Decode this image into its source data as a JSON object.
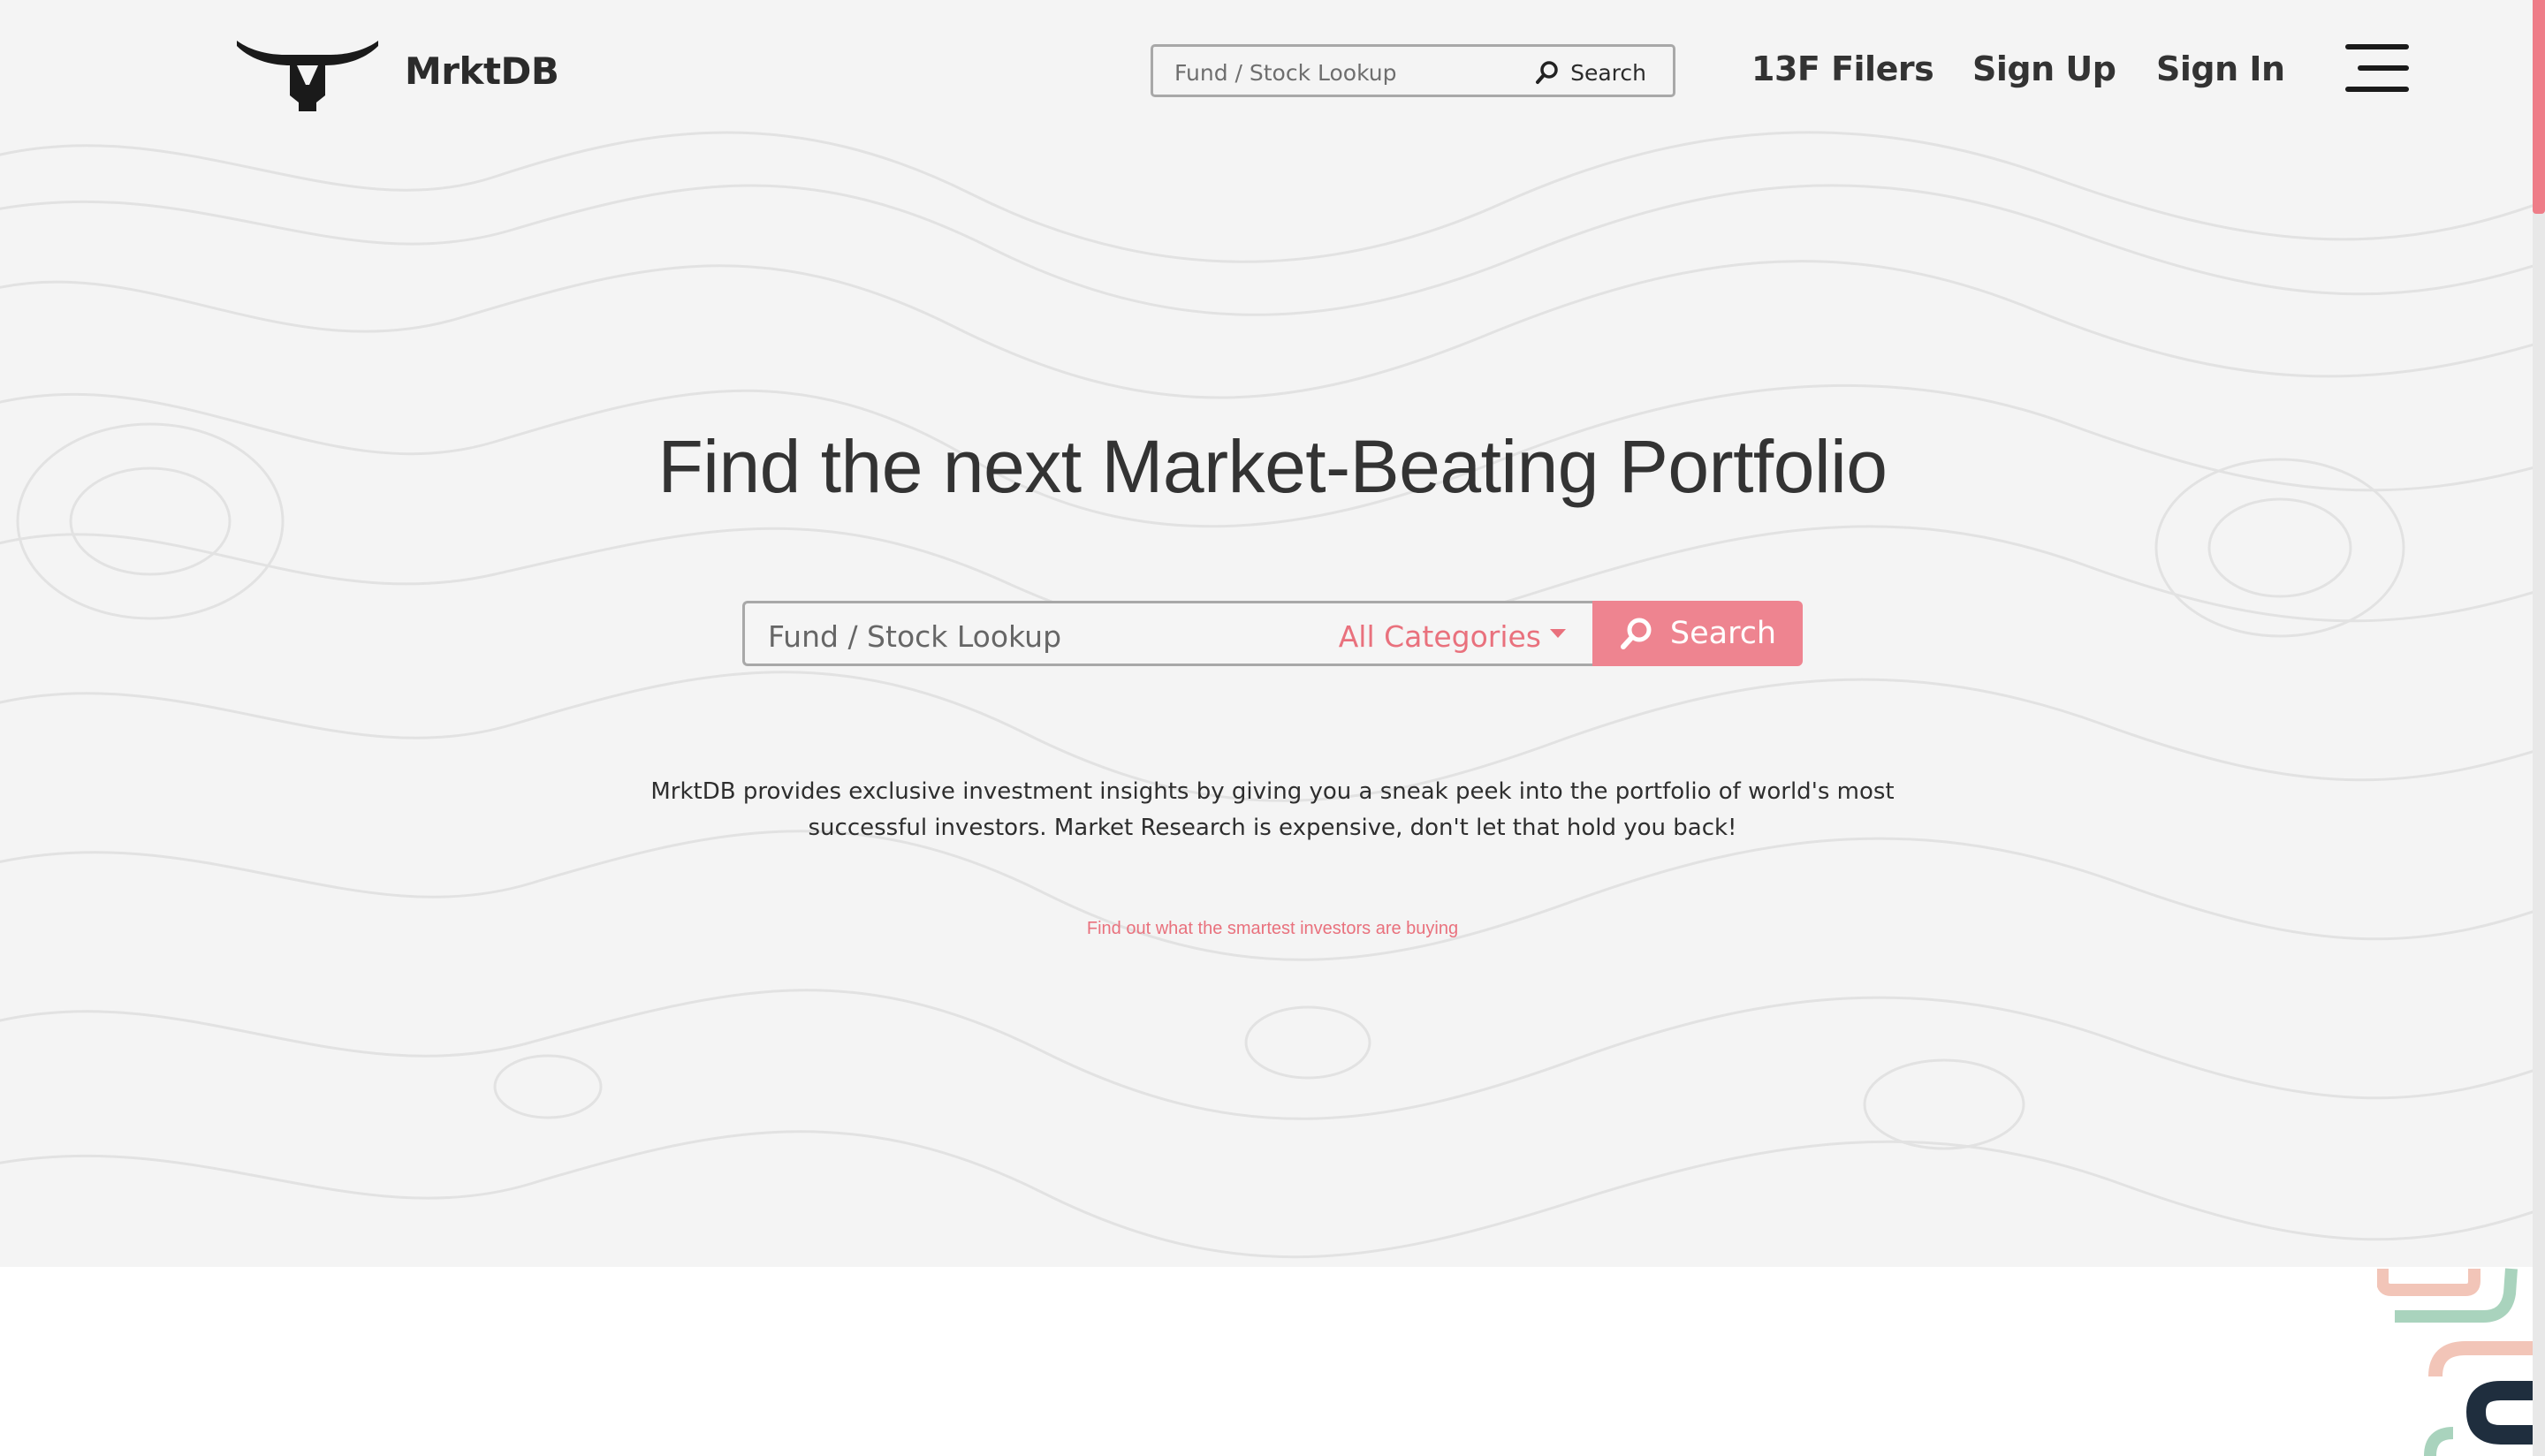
{
  "header": {
    "brand": "MrktDB",
    "search": {
      "placeholder": "Fund / Stock Lookup",
      "button_label": "Search"
    },
    "nav": [
      {
        "label": "13F Filers"
      },
      {
        "label": "Sign Up"
      },
      {
        "label": "Sign In"
      }
    ]
  },
  "hero": {
    "headline": "Find the next Market-Beating Portfolio",
    "search": {
      "placeholder": "Fund / Stock Lookup",
      "category": "All Categories",
      "button_label": "Search"
    },
    "description": "MrktDB provides exclusive investment insights by giving you a sneak peek into the portfolio of world's most successful investors. Market Research is expensive, don't let that hold you back!",
    "tagline": "Find out what the smartest investors are buying"
  },
  "colors": {
    "accent": "#ee8490",
    "accent_text": "#e9717d",
    "hero_background": "#f4f4f4",
    "text": "#333333"
  },
  "icons": [
    "logo-bull-icon",
    "search-icon",
    "menu-icon"
  ]
}
